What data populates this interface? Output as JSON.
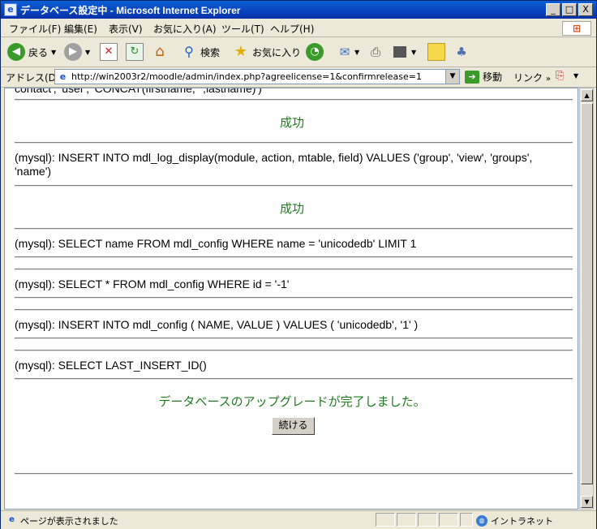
{
  "window": {
    "title": "データベース設定中 - Microsoft Internet Explorer",
    "minimize_label": "_",
    "maximize_label": "□",
    "close_label": "X"
  },
  "menu": [
    {
      "label": "ファイル(F)"
    },
    {
      "label": "編集(E)"
    },
    {
      "label": "表示(V)"
    },
    {
      "label": "お気に入り(A)"
    },
    {
      "label": "ツール(T)"
    },
    {
      "label": "ヘルプ(H)"
    }
  ],
  "toolbar": {
    "back_label": "戻る",
    "search_label": "検索",
    "favorites_label": "お気に入り"
  },
  "address": {
    "label": "アドレス(D)",
    "url": "http://win2003r2/moodle/admin/index.php?agreelicense=1&confirmrelease=1",
    "go_label": "移動",
    "links_label": "リンク"
  },
  "content": {
    "partial_top": "contact', 'user', 'CONCAT(firstname,' ',lastname)')",
    "success_1": "成功",
    "sql_1": "(mysql): INSERT INTO mdl_log_display(module, action, mtable, field) VALUES ('group', 'view', 'groups', 'name')",
    "success_2": "成功",
    "sql_2": "(mysql): SELECT name FROM mdl_config WHERE name = 'unicodedb' LIMIT 1",
    "sql_3": "(mysql): SELECT * FROM mdl_config WHERE id = '-1'",
    "sql_4": "(mysql): INSERT INTO mdl_config ( NAME, VALUE ) VALUES ( 'unicodedb', '1' )",
    "sql_5": "(mysql): SELECT LAST_INSERT_ID()",
    "complete_message": "データベースのアップグレードが完了しました。",
    "continue_label": "続ける"
  },
  "status": {
    "text": "ページが表示されました",
    "zone": "イントラネット"
  },
  "colors": {
    "success_green": "#1f7a1f",
    "title_blue": "#0a5fd8"
  }
}
